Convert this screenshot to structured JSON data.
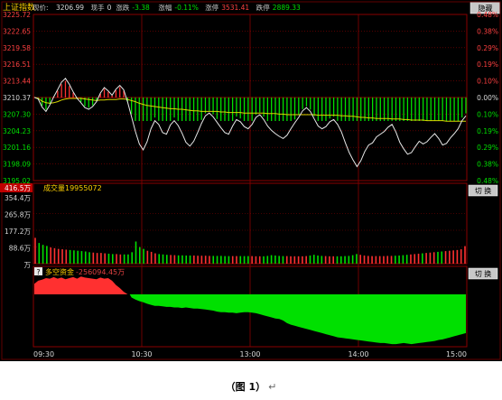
{
  "index_name": "上证指数",
  "header": [
    {
      "label": "现价:",
      "value": "3206.99",
      "color": "#d8d8d8"
    },
    {
      "label": "现手",
      "value": "0",
      "color": "#d8d8d8"
    },
    {
      "label": "涨跌",
      "value": "-3.38",
      "color": "#00e000"
    },
    {
      "label": "涨幅",
      "value": "-0.11%",
      "color": "#00e000"
    },
    {
      "label": "涨停",
      "value": "3531.41",
      "color": "#ff4040"
    },
    {
      "label": "跌停",
      "value": "2889.33",
      "color": "#00e000"
    }
  ],
  "buttons": {
    "top_right": "隐藏",
    "switch_label": "切 换"
  },
  "panels": {
    "volume_label": "成交量",
    "volume_value": "19955072",
    "capital_icon": "?",
    "capital_label": "多空资金",
    "capital_value": "-256094.45万"
  },
  "caption": {
    "text": "（图 1）",
    "mark": "↵"
  },
  "colors": {
    "up": "#ff3030",
    "down": "#00e000",
    "price_line": "#e8e8e8",
    "avg_line": "#d8d800",
    "grid": "#8a0000",
    "background": "#000000"
  },
  "chart_data": [
    {
      "type": "line",
      "title": "上证指数 分时",
      "x_ticks": [
        "09:30",
        "10:30",
        "13:00",
        "14:00",
        "15:00"
      ],
      "y_ticks_left": [
        "3225.72",
        "3222.65",
        "3219.58",
        "3216.51",
        "3213.44",
        "3210.37",
        "3207.30",
        "3204.23",
        "3201.16",
        "3198.09",
        "3195.02"
      ],
      "y_ticks_right": [
        "0.48%",
        "0.38%",
        "0.29%",
        "0.19%",
        "0.10%",
        "0.00%",
        "0.10%",
        "0.19%",
        "0.29%",
        "0.38%",
        "0.48%"
      ],
      "ylim": [
        3195.02,
        3225.72
      ],
      "reference": 3210.37,
      "series": [
        {
          "values": [
            3210.4,
            3210.1,
            3208.6,
            3207.8,
            3209.0,
            3210.5,
            3211.8,
            3213.2,
            3213.9,
            3212.8,
            3211.4,
            3210.2,
            3209.4,
            3208.5,
            3208.2,
            3208.7,
            3209.6,
            3211.2,
            3212.2,
            3211.6,
            3210.8,
            3211.9,
            3212.6,
            3211.8,
            3209.5,
            3206.8,
            3204.1,
            3201.8,
            3200.7,
            3202.2,
            3204.6,
            3206.1,
            3205.4,
            3203.9,
            3203.6,
            3205.3,
            3206.1,
            3205.2,
            3203.8,
            3202.1,
            3201.4,
            3202.3,
            3203.9,
            3205.6,
            3207.0,
            3207.5,
            3206.8,
            3205.8,
            3204.8,
            3203.9,
            3203.6,
            3205.1,
            3206.3,
            3205.9,
            3205.0,
            3204.6,
            3205.4,
            3206.7,
            3207.2,
            3206.3,
            3205.1,
            3204.3,
            3203.7,
            3203.2,
            3202.8,
            3203.4,
            3204.6,
            3205.7,
            3206.7,
            3207.9,
            3208.5,
            3207.8,
            3206.4,
            3205.1,
            3204.6,
            3205.0,
            3205.9,
            3206.3,
            3205.4,
            3204.0,
            3202.0,
            3200.2,
            3198.8,
            3197.6,
            3198.7,
            3200.4,
            3201.6,
            3202.0,
            3203.1,
            3203.6,
            3204.1,
            3204.9,
            3205.4,
            3204.0,
            3202.1,
            3200.9,
            3199.9,
            3200.2,
            3201.3,
            3202.3,
            3201.8,
            3202.2,
            3203.0,
            3203.7,
            3202.8,
            3201.6,
            3201.9,
            3202.9,
            3203.7,
            3204.6,
            3206.1,
            3206.99
          ]
        },
        {
          "values": [
            3210.4,
            3210.2,
            3209.7,
            3209.4,
            3209.3,
            3209.4,
            3209.6,
            3209.9,
            3210.1,
            3210.2,
            3210.2,
            3210.2,
            3210.2,
            3210.1,
            3210.0,
            3209.9,
            3209.8,
            3209.9,
            3209.9,
            3210.0,
            3210.0,
            3210.0,
            3210.1,
            3210.1,
            3210.0,
            3209.8,
            3209.6,
            3209.3,
            3209.1,
            3208.9,
            3208.8,
            3208.7,
            3208.6,
            3208.5,
            3208.4,
            3208.3,
            3208.3,
            3208.2,
            3208.2,
            3208.1,
            3208.0,
            3207.9,
            3207.9,
            3207.8,
            3207.8,
            3207.8,
            3207.8,
            3207.8,
            3207.7,
            3207.7,
            3207.6,
            3207.6,
            3207.6,
            3207.6,
            3207.5,
            3207.5,
            3207.5,
            3207.5,
            3207.5,
            3207.5,
            3207.4,
            3207.4,
            3207.4,
            3207.3,
            3207.3,
            3207.2,
            3207.2,
            3207.2,
            3207.2,
            3207.2,
            3207.2,
            3207.2,
            3207.2,
            3207.1,
            3207.1,
            3207.1,
            3207.1,
            3207.1,
            3207.1,
            3207.0,
            3207.0,
            3206.9,
            3206.9,
            3206.8,
            3206.7,
            3206.7,
            3206.6,
            3206.6,
            3206.5,
            3206.5,
            3206.5,
            3206.5,
            3206.4,
            3206.4,
            3206.4,
            3206.3,
            3206.3,
            3206.2,
            3206.2,
            3206.2,
            3206.2,
            3206.1,
            3206.1,
            3206.1,
            3206.1,
            3206.1,
            3206.0,
            3206.0,
            3206.0,
            3206.0,
            3206.0,
            3206.0
          ]
        }
      ]
    },
    {
      "type": "bar",
      "title": "成交量",
      "y_ticks_left": [
        "416.5万",
        "354.4万",
        "265.8万",
        "177.2万",
        "88.6万",
        "万"
      ],
      "ylim": [
        0,
        416.5
      ],
      "values": [
        140,
        112,
        102,
        96,
        88,
        84,
        80,
        78,
        76,
        74,
        72,
        70,
        68,
        66,
        62,
        60,
        58,
        58,
        56,
        54,
        52,
        52,
        50,
        50,
        50,
        62,
        120,
        90,
        80,
        70,
        64,
        56,
        52,
        50,
        48,
        47,
        46,
        45,
        45,
        44,
        44,
        44,
        43,
        43,
        43,
        42,
        42,
        42,
        42,
        41,
        41,
        41,
        41,
        41,
        41,
        41,
        41,
        40,
        40,
        40,
        42,
        46,
        44,
        42,
        41,
        41,
        40,
        40,
        40,
        40,
        41,
        44,
        48,
        44,
        42,
        41,
        40,
        40,
        40,
        40,
        41,
        42,
        46,
        52,
        48,
        44,
        42,
        41,
        41,
        41,
        41,
        42,
        42,
        43,
        44,
        46,
        48,
        50,
        52,
        54,
        56,
        58,
        60,
        62,
        64,
        66,
        68,
        70,
        72,
        74,
        78,
        95
      ]
    },
    {
      "type": "area",
      "title": "多空资金",
      "values": [
        0.2,
        0.26,
        0.28,
        0.31,
        0.3,
        0.33,
        0.3,
        0.32,
        0.29,
        0.31,
        0.33,
        0.3,
        0.34,
        0.32,
        0.31,
        0.3,
        0.29,
        0.32,
        0.3,
        0.31,
        0.26,
        0.18,
        0.12,
        0.05,
        0.0,
        -0.06,
        -0.1,
        -0.13,
        -0.15,
        -0.18,
        -0.2,
        -0.22,
        -0.22,
        -0.23,
        -0.24,
        -0.24,
        -0.25,
        -0.25,
        -0.26,
        -0.25,
        -0.26,
        -0.27,
        -0.27,
        -0.28,
        -0.29,
        -0.3,
        -0.31,
        -0.33,
        -0.34,
        -0.34,
        -0.35,
        -0.35,
        -0.36,
        -0.35,
        -0.34,
        -0.34,
        -0.35,
        -0.36,
        -0.38,
        -0.4,
        -0.42,
        -0.44,
        -0.46,
        -0.47,
        -0.5,
        -0.55,
        -0.58,
        -0.6,
        -0.62,
        -0.64,
        -0.66,
        -0.68,
        -0.7,
        -0.72,
        -0.74,
        -0.76,
        -0.78,
        -0.8,
        -0.82,
        -0.83,
        -0.84,
        -0.85,
        -0.86,
        -0.87,
        -0.88,
        -0.89,
        -0.9,
        -0.91,
        -0.92,
        -0.93,
        -0.93,
        -0.94,
        -0.95,
        -0.95,
        -0.94,
        -0.93,
        -0.94,
        -0.95,
        -0.94,
        -0.93,
        -0.92,
        -0.91,
        -0.9,
        -0.89,
        -0.87,
        -0.86,
        -0.84,
        -0.82,
        -0.8,
        -0.78,
        -0.76,
        -0.74
      ]
    }
  ]
}
